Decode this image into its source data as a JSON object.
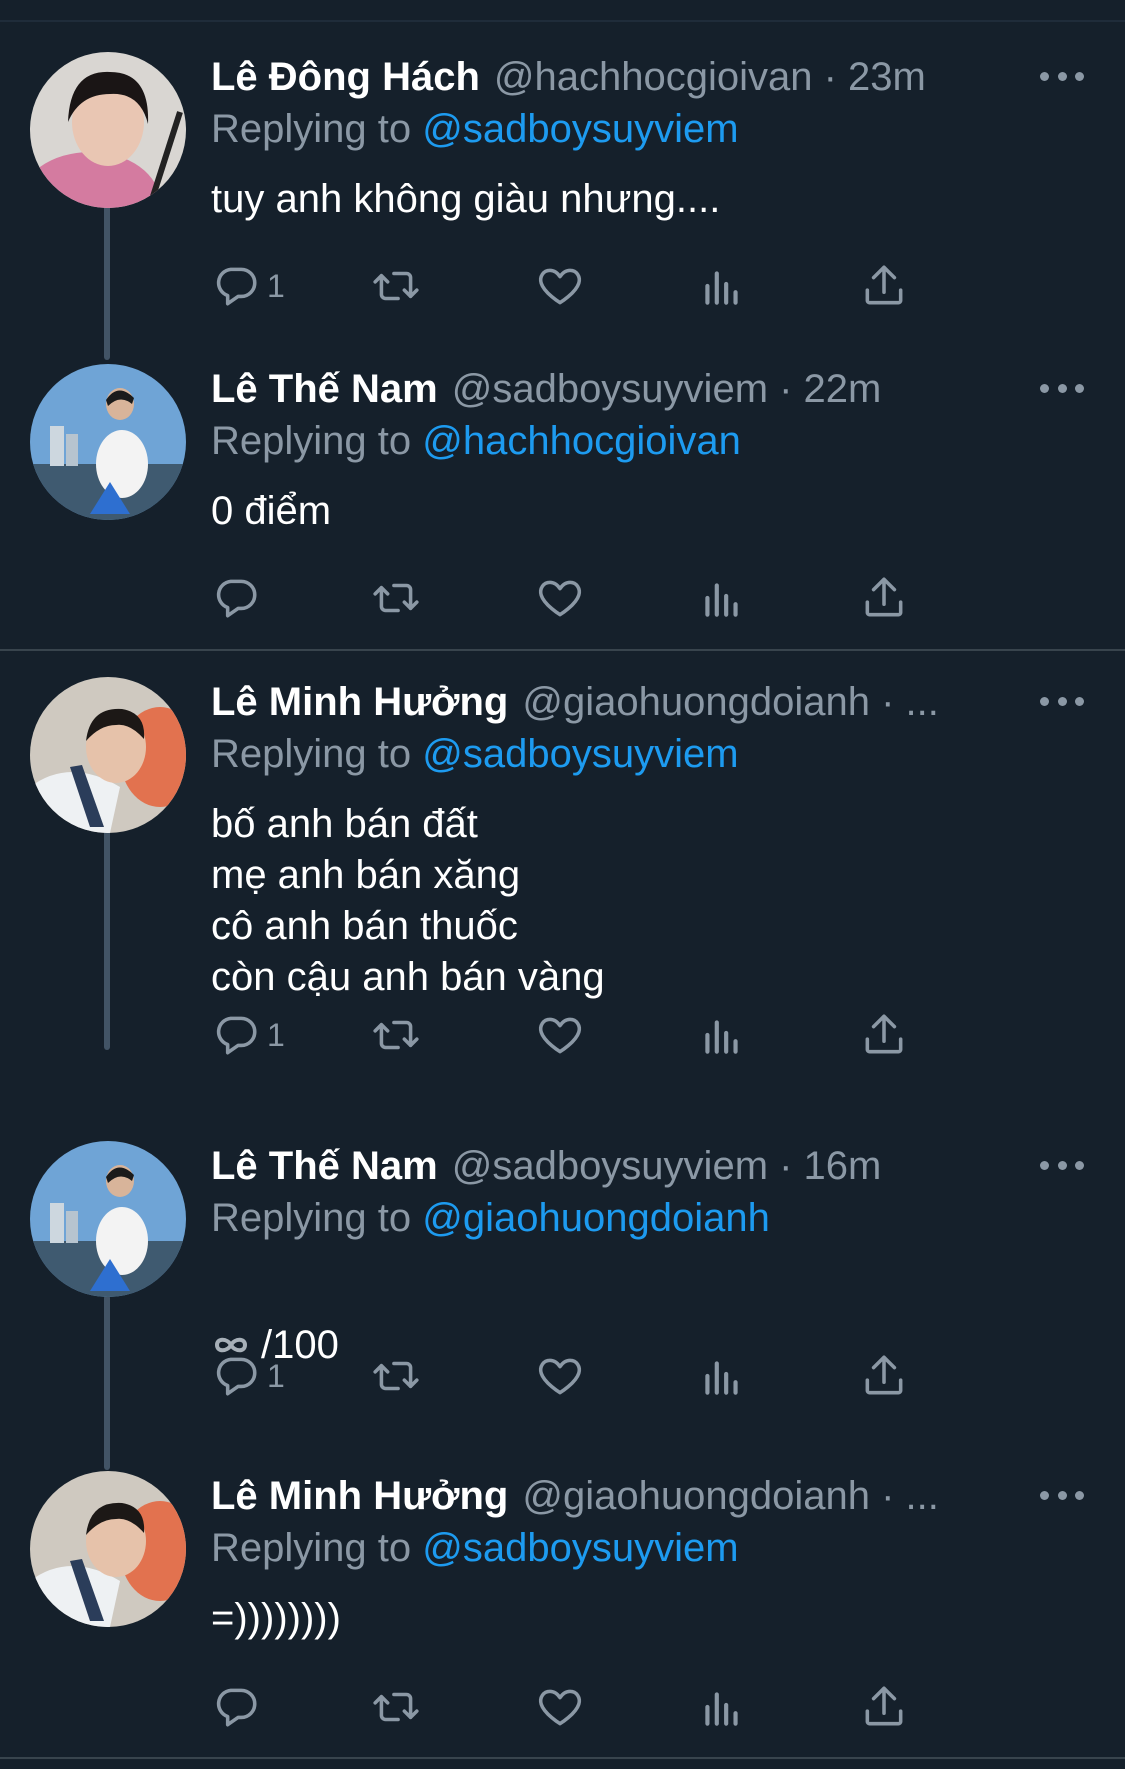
{
  "tweets": [
    {
      "name": "Lê Đông Hách",
      "handle_time": "@hachhocgioivan · 23m",
      "replying_prefix": "Replying to ",
      "replying_to": "@sadboysuyviem",
      "text": "tuy anh không giàu nhưng....",
      "reply_count": "1",
      "avatar_icon": "avatar-photo-pink-hoodie"
    },
    {
      "name": "Lê Thế Nam",
      "handle_time": "@sadboysuyviem · 22m",
      "replying_prefix": "Replying to ",
      "replying_to": "@hachhocgioivan",
      "text": "0 điểm",
      "reply_count": "",
      "avatar_icon": "avatar-photo-waterfront"
    },
    {
      "name": "Lê Minh Hưởng",
      "handle_time": "@giaohuongdoianh · ...",
      "replying_prefix": "Replying to ",
      "replying_to": "@sadboysuyviem",
      "text": "bố anh bán đất\nmẹ anh bán xăng\ncô anh bán thuốc\ncòn cậu anh bán vàng",
      "reply_count": "1",
      "avatar_icon": "avatar-photo-smiling"
    },
    {
      "name": "Lê Thế Nam",
      "handle_time": "@sadboysuyviem · 16m",
      "replying_prefix": "Replying to ",
      "replying_to": "@giaohuongdoianh",
      "text": "/100",
      "text_icon": "infinity-icon",
      "reply_count": "1",
      "avatar_icon": "avatar-photo-waterfront"
    },
    {
      "name": "Lê Minh Hưởng",
      "handle_time": "@giaohuongdoianh · ...",
      "replying_prefix": "Replying to ",
      "replying_to": "@sadboysuyviem",
      "text": "=))))))))",
      "reply_count": "",
      "avatar_icon": "avatar-photo-smiling"
    }
  ],
  "colors": {
    "background": "#15202b",
    "text": "#ffffff",
    "secondary": "#8b98a5",
    "link": "#1d9bf0",
    "divider": "#38444d",
    "thread_line": "#425466"
  }
}
